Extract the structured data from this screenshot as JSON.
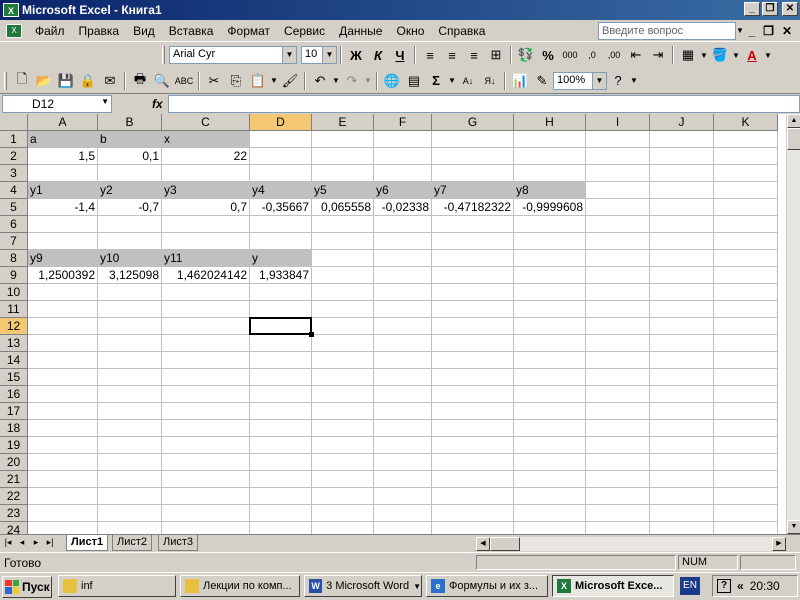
{
  "window": {
    "title": "Microsoft Excel - Книга1"
  },
  "menu": [
    "Файл",
    "Правка",
    "Вид",
    "Вставка",
    "Формат",
    "Сервис",
    "Данные",
    "Окно",
    "Справка"
  ],
  "ask": {
    "placeholder": "Введите вопрос"
  },
  "format_toolbar": {
    "font": "Arial Cyr",
    "size": "10",
    "bold": "Ж",
    "italic": "К",
    "underline": "Ч",
    "percent": "%",
    "thousands": "000"
  },
  "std_toolbar": {
    "zoom": "100%",
    "sigma": "Σ"
  },
  "formula_bar": {
    "name_box": "D12",
    "fx": "fx",
    "content": ""
  },
  "columns": [
    "A",
    "B",
    "C",
    "D",
    "E",
    "F",
    "G",
    "H",
    "I",
    "J",
    "K"
  ],
  "selected_column": "D",
  "selected_row": "12",
  "rows": [
    "1",
    "2",
    "3",
    "4",
    "5",
    "6",
    "7",
    "8",
    "9",
    "10",
    "11",
    "12",
    "13",
    "14",
    "15",
    "16",
    "17",
    "18",
    "19",
    "20",
    "21",
    "22",
    "23",
    "24"
  ],
  "cells": {
    "r1": [
      "a",
      "b",
      "x"
    ],
    "r2": [
      "1,5",
      "0,1",
      "22"
    ],
    "r4": [
      "y1",
      "y2",
      "y3",
      "y4",
      "y5",
      "y6",
      "y7",
      "y8"
    ],
    "r5": [
      "-1,4",
      "-0,7",
      "0,7",
      "-0,35667",
      "0,065558",
      "-0,02338",
      "-0,47182322",
      "-0,9999608"
    ],
    "r8": [
      "y9",
      "y10",
      "y11",
      "y"
    ],
    "r9": [
      "1,2500392",
      "3,125098",
      "1,462024142",
      "1,933847"
    ]
  },
  "sheets": [
    "Лист1",
    "Лист2",
    "Лист3"
  ],
  "active_sheet": "Лист1",
  "status": {
    "text": "Готово",
    "num": "NUM"
  },
  "taskbar": {
    "start": "Пуск",
    "items": [
      "inf",
      "Лекции по комп...",
      "3 Microsoft Word",
      "Формулы и их з...",
      "Microsoft Exce..."
    ],
    "active_item": "Microsoft Exce...",
    "lang": "EN",
    "time": "20:30"
  }
}
